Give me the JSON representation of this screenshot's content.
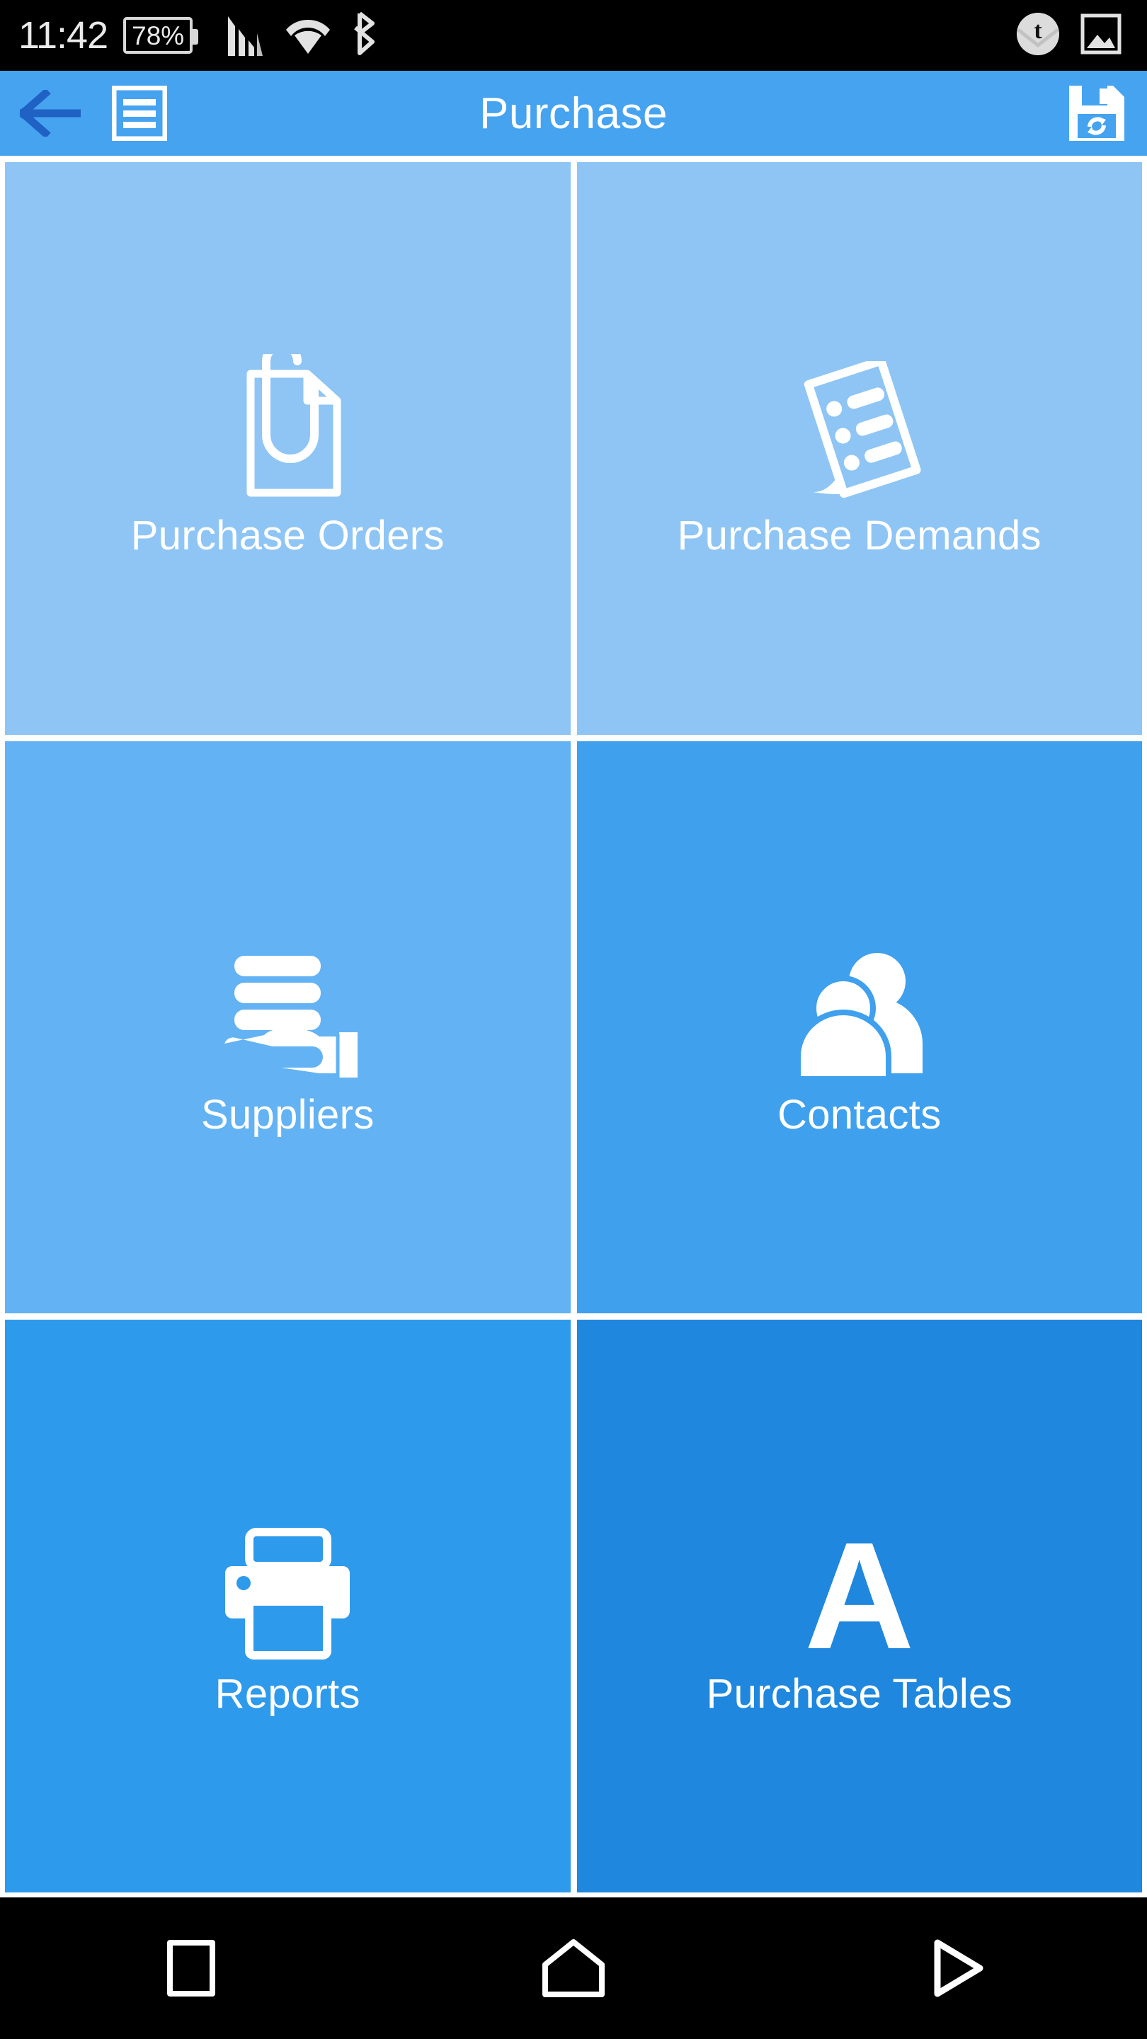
{
  "status_bar": {
    "time": "11:42",
    "battery_percent": "78%",
    "icons_left": [
      "signal-bars-icon",
      "wifi-icon",
      "bluetooth-icon"
    ],
    "icons_right": [
      "tumblr-mail-notification-icon",
      "screenshot-image-icon"
    ],
    "background": "#000000",
    "foreground": "#eaeaea"
  },
  "app_bar": {
    "title": "Purchase",
    "back_icon": "back-arrow-icon",
    "menu_icon": "list-menu-icon",
    "save_icon": "save-sync-floppy-icon",
    "background": "#46a3f0",
    "title_color": "#ffffff",
    "back_arrow_color": "#1f62c4"
  },
  "grid": {
    "tiles": [
      {
        "label": "Purchase Orders",
        "icon": "document-paperclip-icon",
        "color": "#8ec5f5"
      },
      {
        "label": "Purchase Demands",
        "icon": "tilted-checklist-document-icon",
        "color": "#8ec5f5"
      },
      {
        "label": "Suppliers",
        "icon": "hand-holding-stack-icon",
        "color": "#63b2f3"
      },
      {
        "label": "Contacts",
        "icon": "two-people-icon",
        "color": "#3fa0ee"
      },
      {
        "label": "Reports",
        "icon": "printer-icon",
        "color": "#2e9aec"
      },
      {
        "label": "Purchase Tables",
        "icon": "letter-a-icon",
        "color": "#1f87dd",
        "glyph": "A"
      }
    ],
    "gap_color": "#ffffff"
  },
  "nav_bar": {
    "background": "#000000",
    "buttons": [
      {
        "name": "recents-square-icon"
      },
      {
        "name": "home-icon"
      },
      {
        "name": "back-triangle-icon"
      }
    ]
  }
}
